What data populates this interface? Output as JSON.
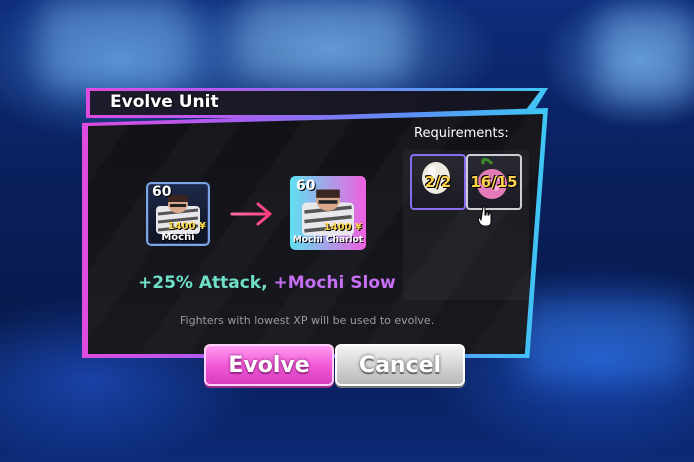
{
  "dialog": {
    "title": "Evolve Unit"
  },
  "source_unit": {
    "level": "60",
    "cost": "1400 ¥",
    "name": "Mochi"
  },
  "target_unit": {
    "level": "60",
    "cost": "1400 ¥",
    "name": "Mochi Charlot"
  },
  "buffs": {
    "part1": "+25% Attack,",
    "part2": "+Mochi Slow"
  },
  "note": "Fighters with lowest XP will be used to evolve.",
  "requirements": {
    "label": "Requirements:",
    "items": [
      {
        "icon": "egg-icon",
        "count": "2/2"
      },
      {
        "icon": "mochi-fruit-icon",
        "count": "16/15"
      }
    ]
  },
  "buttons": {
    "evolve": "Evolve",
    "cancel": "Cancel"
  },
  "colors": {
    "evolve": "#f25ad8",
    "cancel": "#d6d6d6",
    "count": "#ffd34a"
  }
}
